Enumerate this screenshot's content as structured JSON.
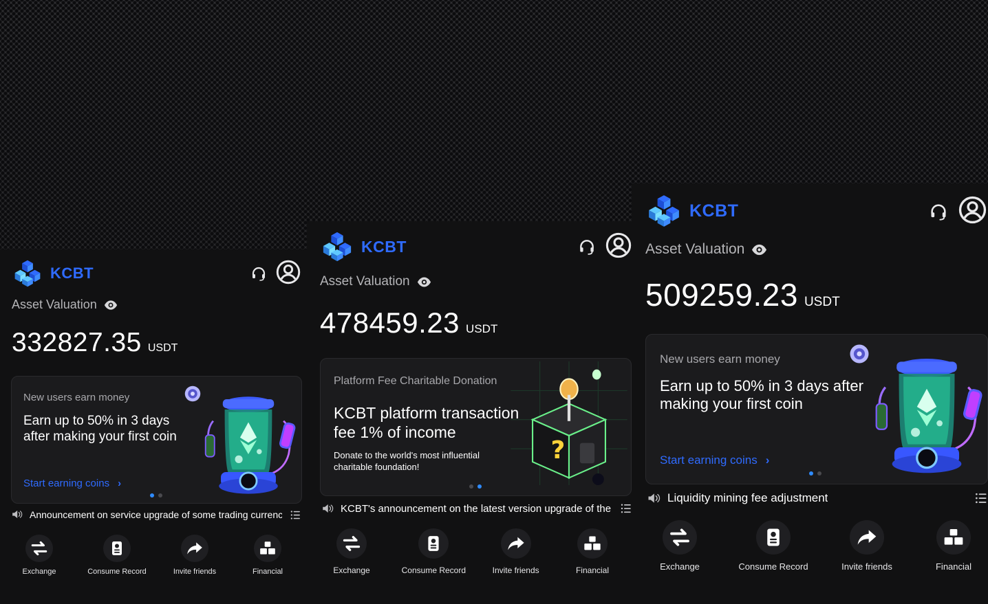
{
  "panels": [
    {
      "brand": "KCBT",
      "asset_label": "Asset Valuation",
      "amount": "332827.35",
      "unit": "USDT",
      "banner": {
        "kicker": "New users earn money",
        "headline": "Earn up to 50% in 3 days after making your first coin",
        "cta": "Start earning coins",
        "active_slide": 1,
        "slides": 2
      },
      "announcement": "Announcement on service upgrade of some trading currencies",
      "actions": [
        {
          "label": "Exchange",
          "icon": "exchange-icon"
        },
        {
          "label": "Consume Record",
          "icon": "record-icon"
        },
        {
          "label": "Invite friends",
          "icon": "share-icon"
        },
        {
          "label": "Financial",
          "icon": "financial-icon"
        }
      ]
    },
    {
      "brand": "KCBT",
      "asset_label": "Asset Valuation",
      "amount": "478459.23",
      "unit": "USDT",
      "banner": {
        "kicker": "Platform Fee Charitable Donation",
        "headline": "KCBT platform transaction fee 1% of income",
        "sub": "Donate to the world's most influential charitable foundation!",
        "active_slide": 2,
        "slides": 2
      },
      "announcement": "KCBT's announcement on the latest version upgrade of the platform",
      "actions": [
        {
          "label": "Exchange",
          "icon": "exchange-icon"
        },
        {
          "label": "Consume Record",
          "icon": "record-icon"
        },
        {
          "label": "Invite friends",
          "icon": "share-icon"
        },
        {
          "label": "Financial",
          "icon": "financial-icon"
        }
      ]
    },
    {
      "brand": "KCBT",
      "asset_label": "Asset Valuation",
      "amount": "509259.23",
      "unit": "USDT",
      "banner": {
        "kicker": "New users earn money",
        "headline": "Earn up to 50% in 3 days after making your first coin",
        "cta": "Start earning coins",
        "active_slide": 1,
        "slides": 2
      },
      "announcement": "Liquidity mining fee adjustment",
      "actions": [
        {
          "label": "Exchange",
          "icon": "exchange-icon"
        },
        {
          "label": "Consume Record",
          "icon": "record-icon"
        },
        {
          "label": "Invite friends",
          "icon": "share-icon"
        },
        {
          "label": "Financial",
          "icon": "financial-icon"
        }
      ]
    }
  ],
  "colors": {
    "brand": "#2f6bff",
    "panel_bg": "#111112",
    "card_bg": "#1b1b1d",
    "muted_text": "#b5b5b8",
    "dot_active": "#2f8bff"
  }
}
